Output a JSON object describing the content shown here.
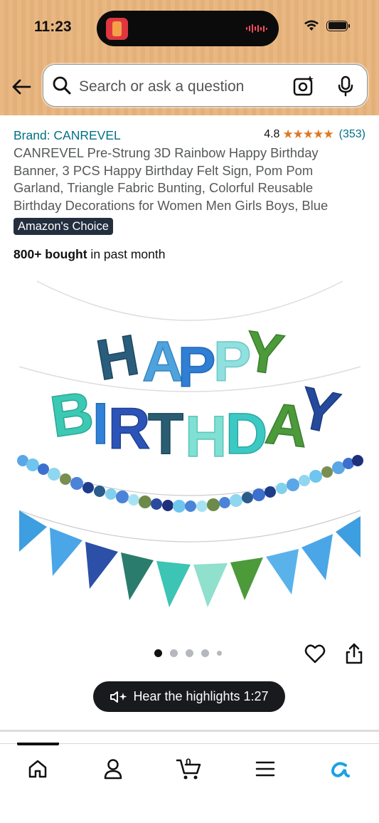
{
  "status_bar": {
    "time": "11:23"
  },
  "search": {
    "placeholder": "Search or ask a question"
  },
  "product": {
    "brand": "Brand: CANREVEL",
    "rating_value": "4.8",
    "rating_count": "(353)",
    "stars": "★★★★★",
    "title": "CANREVEL Pre-Strung 3D Rainbow Happy Birthday Banner, 3 PCS Happy Birthday Felt Sign, Pom Pom Garland, Triangle Fabric Bunting, Colorful Reusable Birthday Decorations for Women Men Girls Boys, Blue",
    "badge": "Amazon's Choice",
    "bought_bold": "800+ bought",
    "bought_rest": " in past month",
    "image": {
      "line1": "HAPPY",
      "line2": "BIRTHDAY"
    }
  },
  "carousel": {
    "total_images": 5,
    "active_index": 0
  },
  "audio": {
    "label": "Hear the highlights 1:27"
  },
  "bottom_nav": {
    "cart_count": "0",
    "items": [
      "home",
      "account",
      "cart",
      "menu",
      "rufus"
    ]
  },
  "colors": {
    "header_bg": "#e9b882",
    "link": "#007185",
    "star": "#de7921",
    "badge_bg": "#232f3e",
    "rufus_accent": "#1aa2e6"
  }
}
